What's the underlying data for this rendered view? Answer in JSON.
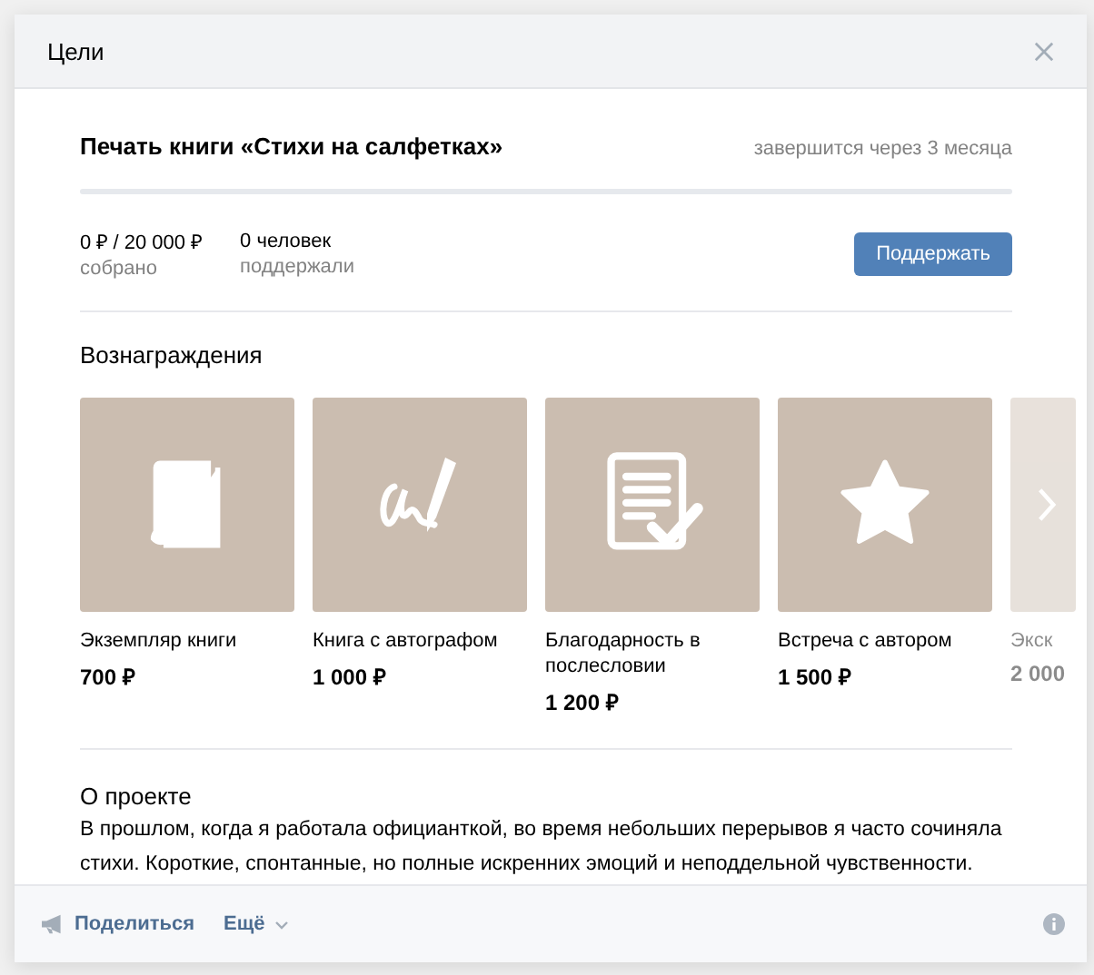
{
  "window": {
    "title": "Цели"
  },
  "goal": {
    "title": "Печать книги «Стихи на салфетках»",
    "deadline": "завершится через 3 месяца",
    "level": 0,
    "stats": [
      {
        "value": "0 ₽ / 20 000 ₽",
        "label": "собрано"
      },
      {
        "value": "0 человек",
        "label": "поддержали"
      }
    ],
    "button": "Поддержать"
  },
  "rewards": {
    "heading": "Вознаграждения",
    "items": [
      {
        "kind": "book",
        "title": "Экземпляр книги",
        "price": "700 ₽",
        "dimmed": false
      },
      {
        "kind": "autograph",
        "title": "Книга с автографом",
        "price": "1 000 ₽",
        "dimmed": false
      },
      {
        "kind": "document",
        "title": "Благодарность в послесловии",
        "price": "1 200 ₽",
        "dimmed": false
      },
      {
        "kind": "star",
        "title": "Встреча с автором",
        "price": "1 500 ₽",
        "dimmed": false
      },
      {
        "kind": "blank",
        "title": "Экск",
        "price": "2 000",
        "dimmed": true
      }
    ]
  },
  "about": {
    "heading": "О проекте",
    "text": "В прошлом, когда я работала официанткой, во время небольших перерывов я часто сочиняла стихи. Короткие, спонтанные, но полные искренних эмоций и неподдельной чувственности."
  },
  "footer": {
    "share": "Поделиться",
    "more": "Ещё"
  }
}
